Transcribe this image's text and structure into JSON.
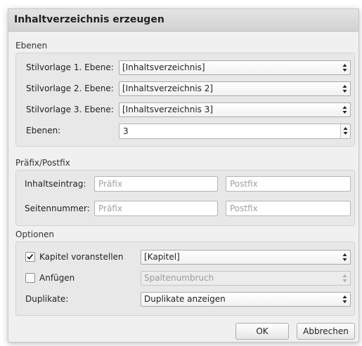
{
  "dialog": {
    "title": "Inhaltverzeichnis erzeugen"
  },
  "ebenen": {
    "heading": "Ebenen",
    "rows": [
      {
        "label": "Stilvorlage 1. Ebene:",
        "value": "[Inhaltsverzeichnis]"
      },
      {
        "label": "Stilvorlage 2. Ebene:",
        "value": "[Inhaltsverzeichnis 2]"
      },
      {
        "label": "Stilvorlage 3. Ebene:",
        "value": "[Inhaltsverzeichnis 3]"
      }
    ],
    "levels_label": "Ebenen:",
    "levels_value": "3"
  },
  "prefix_postfix": {
    "heading": "Präfix/Postfix",
    "rows": [
      {
        "label": "Inhaltseintrag:",
        "prefix_placeholder": "Präfix",
        "postfix_placeholder": "Postfix"
      },
      {
        "label": "Seitennummer:",
        "prefix_placeholder": "Präfix",
        "postfix_placeholder": "Postfix"
      }
    ]
  },
  "options": {
    "heading": "Optionen",
    "prepend_chapter": {
      "label": "Kapitel voranstellen",
      "checked": true,
      "value": "[Kapitel]"
    },
    "append": {
      "label": "Anfügen",
      "checked": false,
      "value": "Spaltenumbruch"
    },
    "duplicates": {
      "label": "Duplikate:",
      "value": "Duplikate anzeigen"
    }
  },
  "buttons": {
    "ok": "OK",
    "cancel": "Abbrechen"
  }
}
